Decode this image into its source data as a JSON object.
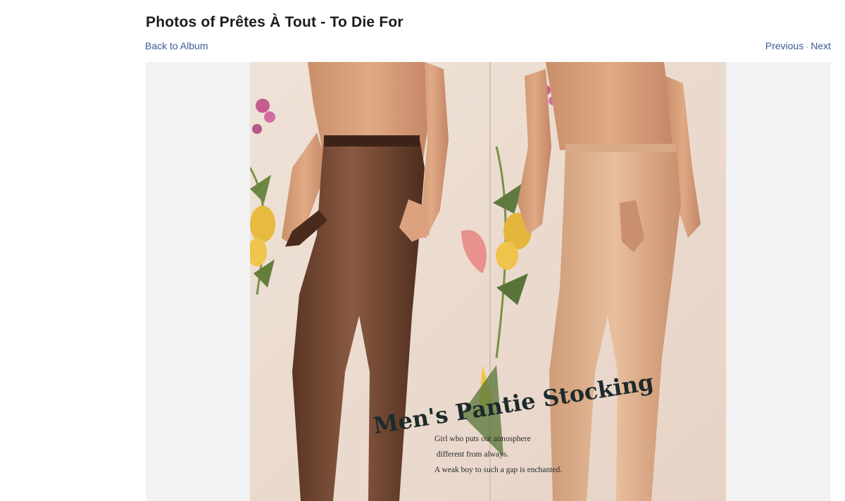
{
  "header": {
    "title": "Photos of Prêtes À Tout - To Die For"
  },
  "nav": {
    "back_label": "Back to Album",
    "previous_label": "Previous",
    "separator": "·",
    "next_label": "Next"
  },
  "photo": {
    "headline": "Men's  Pantie Stocking",
    "body_lines": [
      "Girl who puts out atmosphere",
      " different from always.",
      "A weak boy to such a gap is enchanted."
    ]
  },
  "colors": {
    "link": "#3b5998",
    "stage_bg": "#f2f2f2",
    "photo_bg": "#ecdcd0"
  }
}
